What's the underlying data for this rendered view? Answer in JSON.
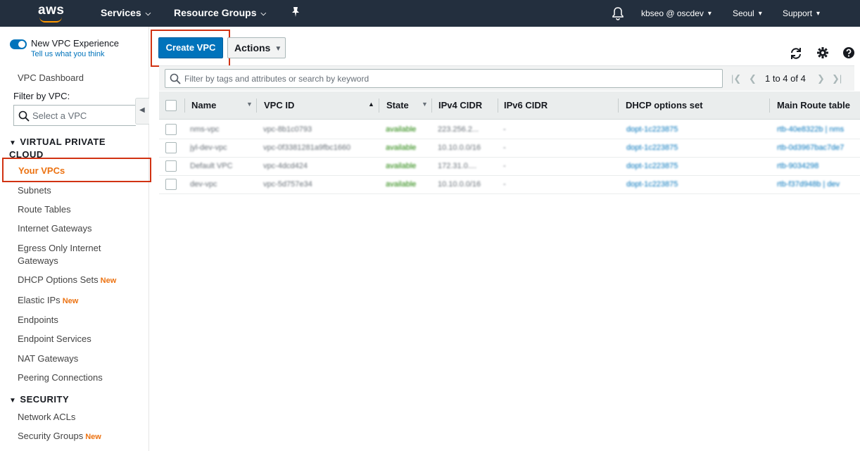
{
  "topnav": {
    "logo": "aws",
    "services": "Services",
    "resource_groups": "Resource Groups",
    "pin_icon": "pin-icon",
    "bell_icon": "bell-icon",
    "account": "kbseo @ oscdev",
    "region": "Seoul",
    "support": "Support"
  },
  "sidebar": {
    "toggle_label": "New VPC Experience",
    "feedback": "Tell us what you think",
    "dashboard": "VPC Dashboard",
    "filter_label": "Filter by VPC:",
    "filter_placeholder": "Select a VPC",
    "sections": {
      "vpc": "VIRTUAL PRIVATE CLOUD",
      "security": "SECURITY"
    },
    "items": [
      {
        "label": "Your VPCs",
        "badge": ""
      },
      {
        "label": "Subnets",
        "badge": ""
      },
      {
        "label": "Route Tables",
        "badge": ""
      },
      {
        "label": "Internet Gateways",
        "badge": ""
      },
      {
        "label": "Egress Only Internet Gateways",
        "badge": ""
      },
      {
        "label": "DHCP Options Sets",
        "badge": "New"
      },
      {
        "label": "Elastic IPs",
        "badge": "New"
      },
      {
        "label": "Endpoints",
        "badge": ""
      },
      {
        "label": "Endpoint Services",
        "badge": ""
      },
      {
        "label": "NAT Gateways",
        "badge": ""
      },
      {
        "label": "Peering Connections",
        "badge": ""
      }
    ],
    "security_items": [
      {
        "label": "Network ACLs",
        "badge": ""
      },
      {
        "label": "Security Groups",
        "badge": "New"
      }
    ]
  },
  "toolbar": {
    "create_label": "Create VPC",
    "actions_label": "Actions"
  },
  "filter": {
    "placeholder": "Filter by tags and attributes or search by keyword",
    "pagination": "1 to 4 of 4"
  },
  "table": {
    "columns": [
      "Name",
      "VPC ID",
      "State",
      "IPv4 CIDR",
      "IPv6 CIDR",
      "DHCP options set",
      "Main Route table"
    ],
    "rows": [
      {
        "name": "nms-vpc",
        "vpc_id": "vpc-8b1c0793",
        "state": "available",
        "ipv4": "223.256.2...",
        "ipv6": "-",
        "dhcp": "dopt-1c223875",
        "route": "rtb-40e8322b | nms"
      },
      {
        "name": "jyl-dev-vpc",
        "vpc_id": "vpc-0f3381281a9fbc1660",
        "state": "available",
        "ipv4": "10.10.0.0/16",
        "ipv6": "-",
        "dhcp": "dopt-1c223875",
        "route": "rtb-0d3967bac7de7"
      },
      {
        "name": "Default VPC",
        "vpc_id": "vpc-4dcd424",
        "state": "available",
        "ipv4": "172.31.0....",
        "ipv6": "-",
        "dhcp": "dopt-1c223875",
        "route": "rtb-9034298"
      },
      {
        "name": "dev-vpc",
        "vpc_id": "vpc-5d757e34",
        "state": "available",
        "ipv4": "10.10.0.0/16",
        "ipv6": "-",
        "dhcp": "dopt-1c223875",
        "route": "rtb-f37d948b | dev"
      }
    ]
  },
  "colors": {
    "nav_bg": "#232f3e",
    "primary": "#0073bb",
    "accent_orange": "#ec7211",
    "highlight_red": "#d13212",
    "available_green": "#1d8102"
  }
}
